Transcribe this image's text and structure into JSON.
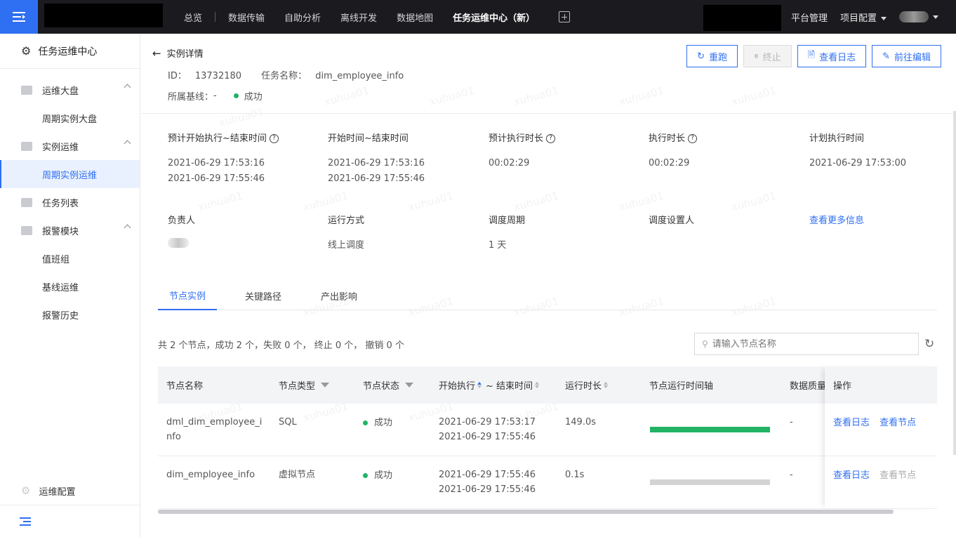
{
  "topbar": {
    "nav": [
      "总览",
      "数据传输",
      "自助分析",
      "离线开发",
      "数据地图",
      "任务运维中心（新）"
    ],
    "active_nav": "任务运维中心（新）",
    "right": {
      "platform": "平台管理",
      "project": "项目配置"
    }
  },
  "sidebar": {
    "title": "任务运维中心",
    "groups": [
      {
        "label": "运维大盘",
        "items": [
          "周期实例大盘"
        ]
      },
      {
        "label": "实例运维",
        "items": [
          "周期实例运维"
        ]
      },
      {
        "label": "任务列表",
        "items": []
      },
      {
        "label": "报警模块",
        "items": [
          "值班组",
          "基线运维",
          "报警历史"
        ]
      }
    ],
    "active_item": "周期实例运维",
    "footer": "运维配置"
  },
  "header": {
    "back_label": "实例详情",
    "id_label": "ID：",
    "id_value": "13732180",
    "task_name_label": "任务名称：",
    "task_name": "dim_employee_info",
    "baseline_label": "所属基线：",
    "baseline_value": "-",
    "status": "成功"
  },
  "actions": {
    "rerun": "重跑",
    "stop": "终止",
    "view_log": "查看日志",
    "edit": "前往编辑"
  },
  "info": {
    "est_range_label": "预计开始执行~结束时间",
    "est_range_start": "2021-06-29 17:53:16",
    "est_range_end": "2021-06-29 17:55:46",
    "range_label": "开始时间~结束时间",
    "range_start": "2021-06-29 17:53:16",
    "range_end": "2021-06-29 17:55:46",
    "est_duration_label": "预计执行时长",
    "est_duration": "00:02:29",
    "duration_label": "执行时长",
    "duration": "00:02:29",
    "plan_time_label": "计划执行时间",
    "plan_time": "2021-06-29 17:53:00",
    "owner_label": "负责人",
    "run_mode_label": "运行方式",
    "run_mode": "线上调度",
    "cycle_label": "调度周期",
    "cycle": "1 天",
    "scheduler_label": "调度设置人",
    "more_link": "查看更多信息"
  },
  "tabs": [
    "节点实例",
    "关键路径",
    "产出影响"
  ],
  "summary": "共 2 个节点，成功 2 个，失败 0 个， 终止 0 个， 撤销 0 个",
  "search": {
    "placeholder": "请输入节点名称"
  },
  "table": {
    "columns": [
      "节点名称",
      "节点类型",
      "节点状态",
      "开始执行",
      "~ 结束时间",
      "运行时长",
      "节点运行时间轴",
      "数据质量",
      "操作"
    ],
    "rows": [
      {
        "name_line1": "dml_dim_employee_i",
        "name_line2": "nfo",
        "type": "SQL",
        "status": "成功",
        "start": "2021-06-29 17:53:17",
        "end": "2021-06-29 17:55:46",
        "duration": "149.0s",
        "quality": "-",
        "bar_color": "#22b365",
        "op_log": "查看日志",
        "op_node": "查看节点",
        "op_node_enabled": true
      },
      {
        "name_line1": "dim_employee_info",
        "name_line2": "",
        "type": "虚拟节点",
        "status": "成功",
        "start": "2021-06-29 17:55:46",
        "end": "2021-06-29 17:55:46",
        "duration": "0.1s",
        "quality": "-",
        "bar_color": "#d3d3d3",
        "op_log": "查看日志",
        "op_node": "查看节点",
        "op_node_enabled": false
      }
    ]
  },
  "watermark": "xuhua01",
  "colors": {
    "accent": "#2f6ff2",
    "success": "#22b365",
    "topbar": "#1b1b1f"
  }
}
